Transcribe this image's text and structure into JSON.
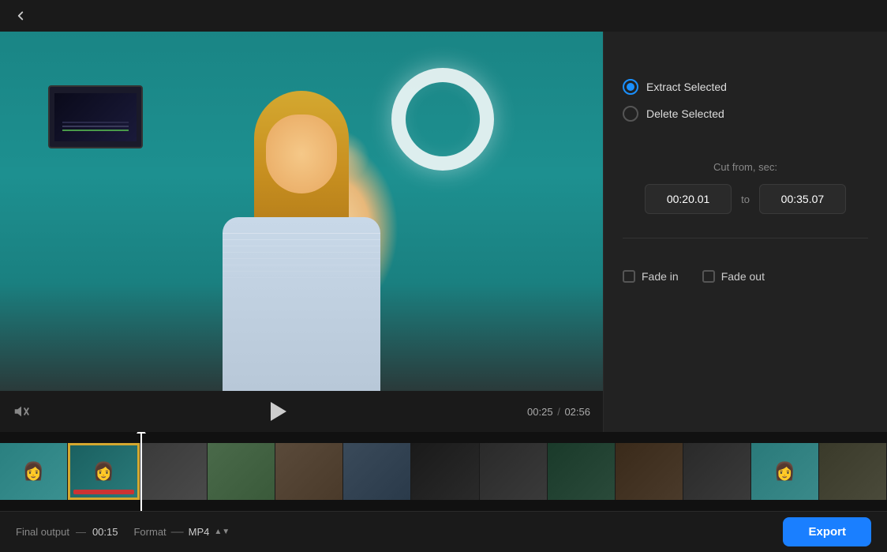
{
  "header": {
    "back_label": "←"
  },
  "video": {
    "current_time": "00:25",
    "total_time": "02:56"
  },
  "right_panel": {
    "extract_selected_label": "Extract Selected",
    "delete_selected_label": "Delete Selected",
    "cut_from_label": "Cut from, sec:",
    "time_from": "00:20.01",
    "to_label": "to",
    "time_to": "00:35.07",
    "fade_in_label": "Fade in",
    "fade_out_label": "Fade out"
  },
  "bottom_bar": {
    "final_output_label": "Final output",
    "dash": "—",
    "duration": "00:15",
    "format_label": "Format",
    "format_dash": "—",
    "format_value": "MP4",
    "export_label": "Export"
  }
}
